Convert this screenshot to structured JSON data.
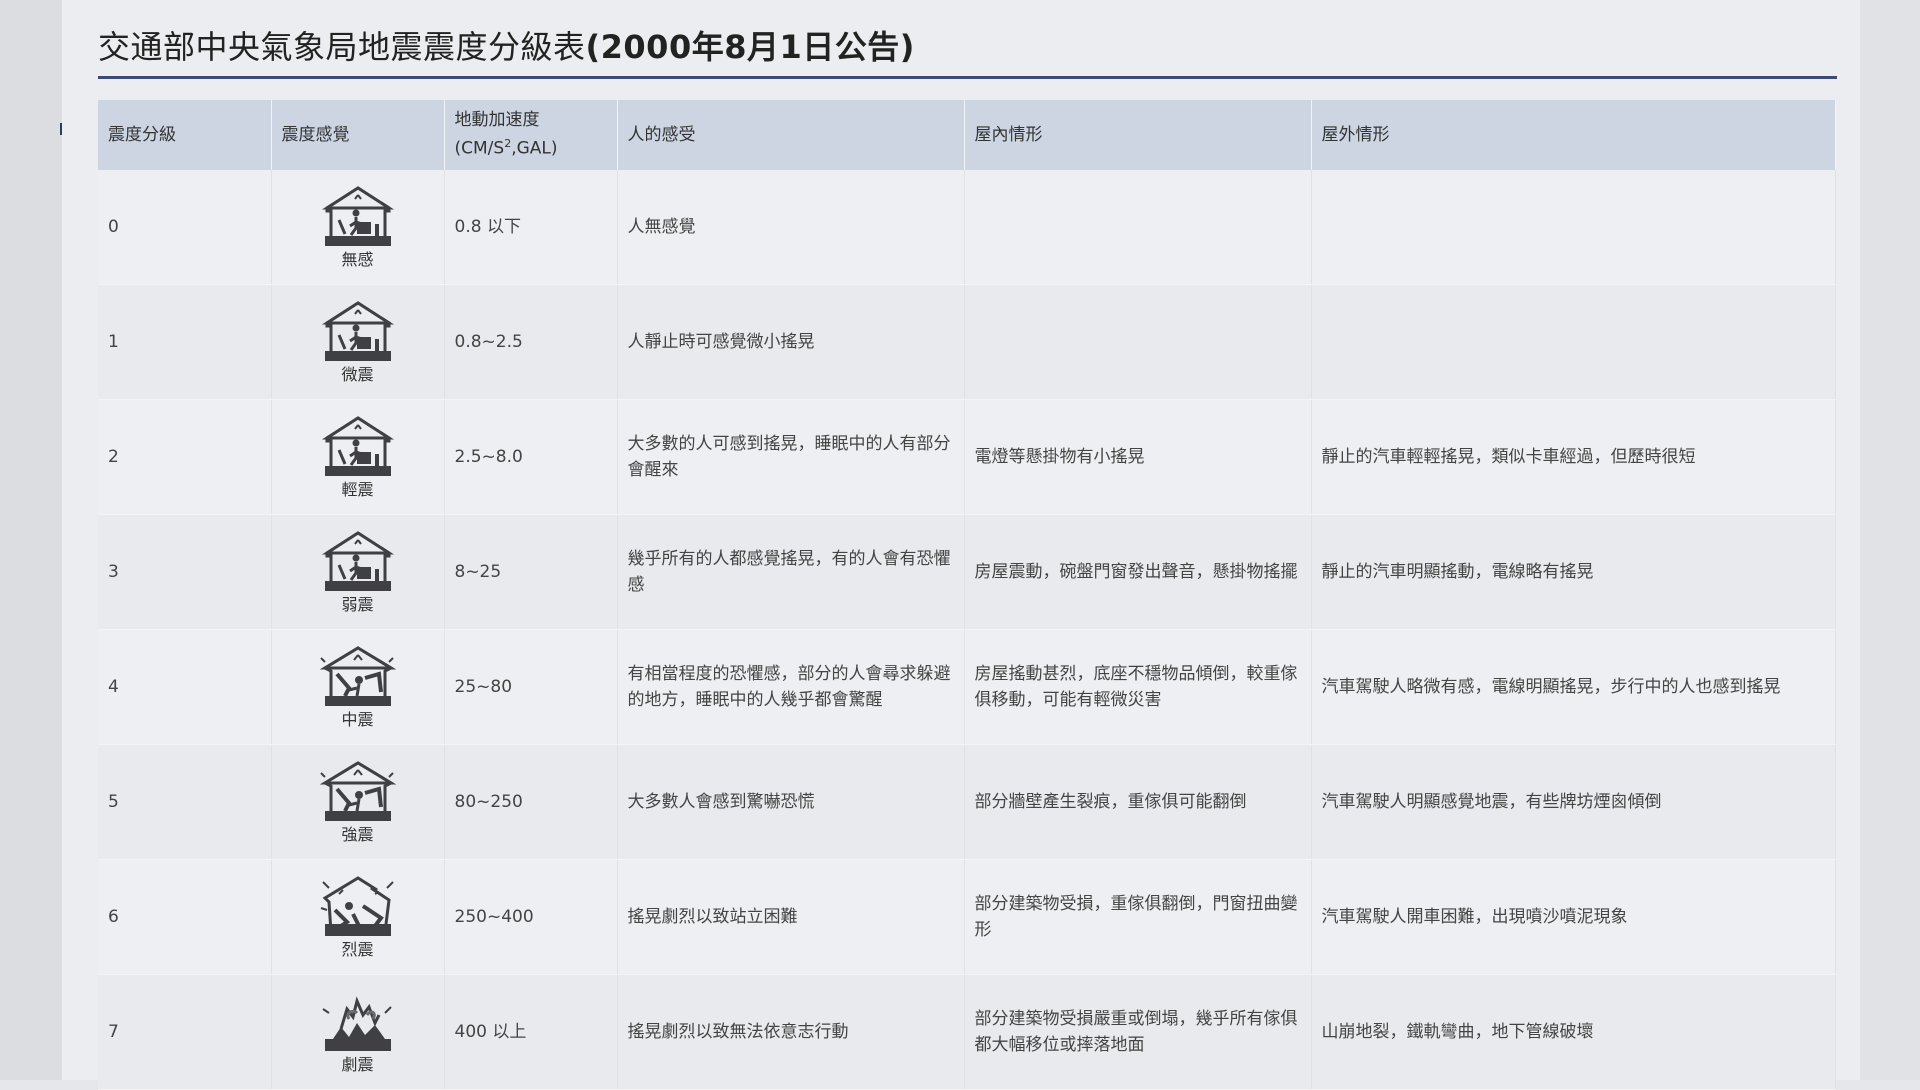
{
  "title": {
    "main": "交通部中央氣象局地震震度分級表",
    "date": "(2000年8月1日公告)"
  },
  "table": {
    "headers": {
      "scale": "震度分級",
      "feel": "震度感覺",
      "accel_line1": "地動加速度",
      "accel_line2_pre": "(CM/S",
      "accel_sup": "2",
      "accel_line2_post": ",GAL)",
      "human": "人的感受",
      "indoor": "屋內情形",
      "outdoor": "屋外情形"
    },
    "rows": [
      {
        "level": "0",
        "icon": "house-calm-icon",
        "label": "無感",
        "accel": "0.8 以下",
        "human": "人無感覺",
        "indoor": "",
        "outdoor": ""
      },
      {
        "level": "1",
        "icon": "house-calm-icon",
        "label": "微震",
        "accel": "0.8~2.5",
        "human": "人靜止時可感覺微小搖晃",
        "indoor": "",
        "outdoor": ""
      },
      {
        "level": "2",
        "icon": "house-calm-icon",
        "label": "輕震",
        "accel": "2.5~8.0",
        "human": "大多數的人可感到搖晃，睡眠中的人有部分會醒來",
        "indoor": "電燈等懸掛物有小搖晃",
        "outdoor": "靜止的汽車輕輕搖晃，類似卡車經過，但歷時很短"
      },
      {
        "level": "3",
        "icon": "house-calm-icon",
        "label": "弱震",
        "accel": "8~25",
        "human": "幾乎所有的人都感覺搖晃，有的人會有恐懼感",
        "indoor": "房屋震動，碗盤門窗發出聲音，懸掛物搖擺",
        "outdoor": "靜止的汽車明顯搖動，電線略有搖晃"
      },
      {
        "level": "4",
        "icon": "house-shake-icon",
        "label": "中震",
        "accel": "25~80",
        "human": "有相當程度的恐懼感，部分的人會尋求躲避的地方，睡眠中的人幾乎都會驚醒",
        "indoor": "房屋搖動甚烈，底座不穩物品傾倒，較重傢俱移動，可能有輕微災害",
        "outdoor": "汽車駕駛人略微有感，電線明顯搖晃，步行中的人也感到搖晃"
      },
      {
        "level": "5",
        "icon": "house-shake-icon",
        "label": "強震",
        "accel": "80~250",
        "human": "大多數人會感到驚嚇恐慌",
        "indoor": "部分牆壁產生裂痕，重傢俱可能翻倒",
        "outdoor": "汽車駕駛人明顯感覺地震，有些牌坊煙囪傾倒"
      },
      {
        "level": "6",
        "icon": "house-damaged-icon",
        "label": "烈震",
        "accel": "250~400",
        "human": "搖晃劇烈以致站立困難",
        "indoor": "部分建築物受損，重傢俱翻倒，門窗扭曲變形",
        "outdoor": "汽車駕駛人開車困難，出現噴沙噴泥現象"
      },
      {
        "level": "7",
        "icon": "house-collapsed-icon",
        "label": "劇震",
        "accel": "400 以上",
        "human": "搖晃劇烈以致無法依意志行動",
        "indoor": "部分建築物受損嚴重或倒塌，幾乎所有傢俱都大幅移位或摔落地面",
        "outdoor": "山崩地裂，鐵軌彎曲，地下管線破壞"
      }
    ]
  }
}
